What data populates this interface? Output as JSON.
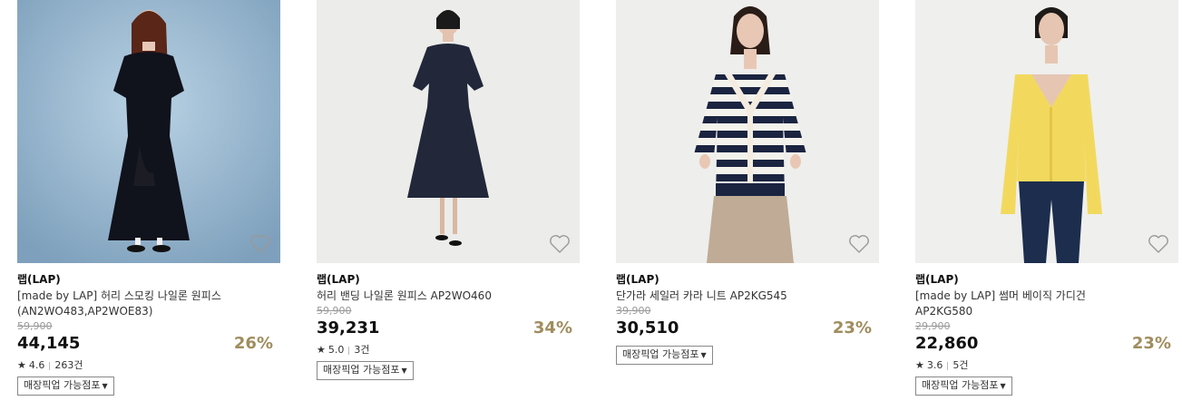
{
  "products": [
    {
      "brand": "랩(LAP)",
      "name": "[made by LAP] 허리 스모킹 나일론 원피스 (AN2WO483,AP2WOE83)",
      "original_price": "59,900",
      "price": "44,145",
      "discount": "26%",
      "rating": "4.6",
      "reviews": "263건",
      "pickup_label": "매장픽업 가능점포",
      "image_subject": "woman in navy smocked midi dress on blue backdrop"
    },
    {
      "brand": "랩(LAP)",
      "name": "허리 밴딩 나일론 원피스 AP2WO460",
      "original_price": "59,900",
      "price": "39,231",
      "discount": "34%",
      "rating": "5.0",
      "reviews": "3건",
      "pickup_label": "매장픽업 가능점포",
      "image_subject": "woman in navy banded nylon dress"
    },
    {
      "brand": "랩(LAP)",
      "name": "단가라 세일러 카라 니트 AP2KG545",
      "original_price": "39,900",
      "price": "30,510",
      "discount": "23%",
      "pickup_label": "매장픽업 가능점포",
      "image_subject": "woman in striped sailor collar knit"
    },
    {
      "brand": "랩(LAP)",
      "name": "[made by LAP] 썸머 베이직 가디건 AP2KG580",
      "original_price": "29,900",
      "price": "22,860",
      "discount": "23%",
      "rating": "3.6",
      "reviews": "5건",
      "pickup_label": "매장픽업 가능점포",
      "image_subject": "woman in yellow basic cardigan and jeans"
    }
  ],
  "icons": {
    "wishlist": "heart-outline-icon",
    "rating": "star-icon",
    "dropdown": "caret-down-icon"
  },
  "colors": {
    "discount": "#a08d5e",
    "original_price": "#999999"
  }
}
